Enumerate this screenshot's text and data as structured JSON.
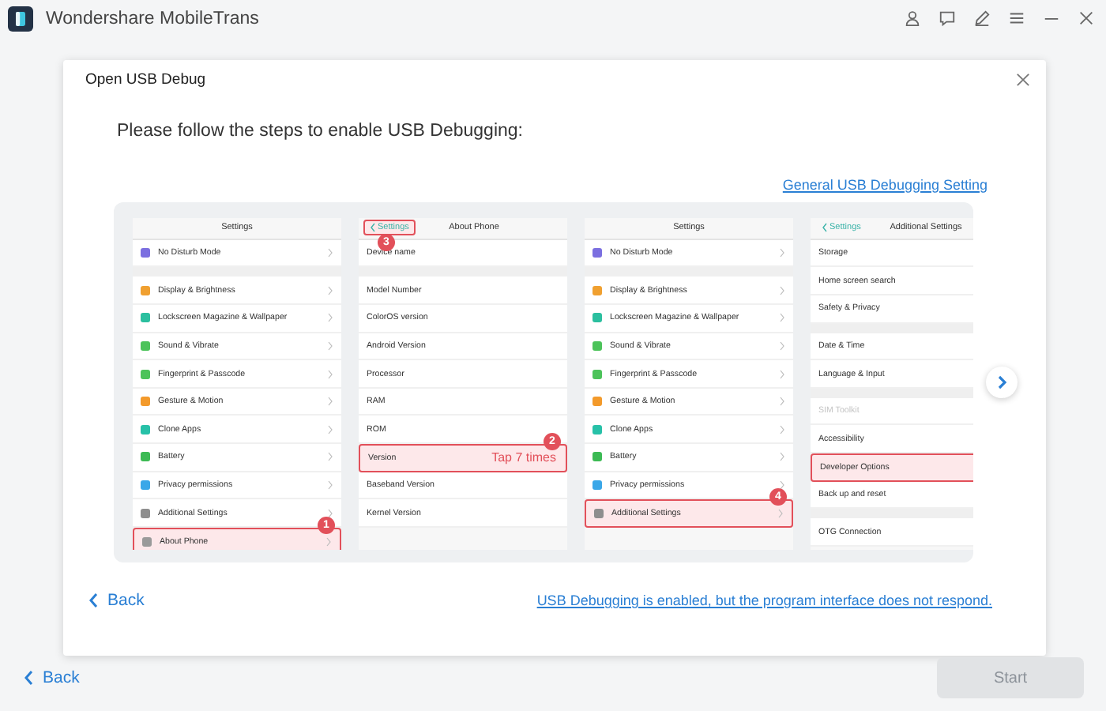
{
  "app": {
    "title": "Wondershare MobileTrans"
  },
  "dialog": {
    "title": "Open USB Debug",
    "instruction": "Please follow the steps to enable USB Debugging:",
    "general_link": "General USB Debugging Setting",
    "back": "Back",
    "problem_link": "USB Debugging is enabled, but the program interface does not respond."
  },
  "phones": [
    {
      "header": {
        "title": "Settings"
      },
      "chevrons": true,
      "rows": [
        {
          "label": "No Disturb Mode",
          "color": "#7b6fe0",
          "gap_before": false,
          "highlighted": false,
          "dimmed": false
        },
        {
          "label": "Display & Brightness",
          "color": "#f0a030",
          "gap_before": true,
          "highlighted": false,
          "dimmed": false
        },
        {
          "label": "Lockscreen Magazine & Wallpaper",
          "color": "#2bbf9f",
          "gap_before": false,
          "highlighted": false,
          "dimmed": false
        },
        {
          "label": "Sound & Vibrate",
          "color": "#4cc35a",
          "gap_before": false,
          "highlighted": false,
          "dimmed": false
        },
        {
          "label": "Fingerprint & Passcode",
          "color": "#4cc35a",
          "gap_before": false,
          "highlighted": false,
          "dimmed": false
        },
        {
          "label": "Gesture & Motion",
          "color": "#f39a2b",
          "gap_before": false,
          "highlighted": false,
          "dimmed": false
        },
        {
          "label": "Clone Apps",
          "color": "#27c1a8",
          "gap_before": false,
          "highlighted": false,
          "dimmed": false
        },
        {
          "label": "Battery",
          "color": "#3cba54",
          "gap_before": false,
          "highlighted": false,
          "dimmed": false
        },
        {
          "label": "Privacy permissions",
          "color": "#3aa7e8",
          "gap_before": false,
          "highlighted": false,
          "dimmed": false
        },
        {
          "label": "Additional Settings",
          "color": "#8e8e8e",
          "gap_before": false,
          "highlighted": false,
          "dimmed": false,
          "badge": "1"
        },
        {
          "label": "About Phone",
          "color": "#9a9a9a",
          "gap_before": false,
          "highlighted": true,
          "dimmed": false
        }
      ]
    },
    {
      "header": {
        "title": "About Phone",
        "back": "Settings",
        "back_highlighted": true,
        "badge": "3"
      },
      "chevrons": false,
      "rows": [
        {
          "label": "Device name",
          "gap_before": false,
          "highlighted": false,
          "dimmed": false
        },
        {
          "label": "Model Number",
          "gap_before": true,
          "highlighted": false,
          "dimmed": false
        },
        {
          "label": "ColorOS version",
          "gap_before": false,
          "highlighted": false,
          "dimmed": false
        },
        {
          "label": "Android Version",
          "gap_before": false,
          "highlighted": false,
          "dimmed": false
        },
        {
          "label": "Processor",
          "gap_before": false,
          "highlighted": false,
          "dimmed": false
        },
        {
          "label": "RAM",
          "gap_before": false,
          "highlighted": false,
          "dimmed": false
        },
        {
          "label": "ROM",
          "gap_before": false,
          "highlighted": false,
          "dimmed": false,
          "badge": "2"
        },
        {
          "label": "Version",
          "gap_before": false,
          "highlighted": true,
          "dimmed": false,
          "note": "Tap 7 times"
        },
        {
          "label": "Baseband Version",
          "gap_before": false,
          "highlighted": false,
          "dimmed": false
        },
        {
          "label": "Kernel Version",
          "gap_before": false,
          "highlighted": false,
          "dimmed": false
        }
      ]
    },
    {
      "header": {
        "title": "Settings"
      },
      "chevrons": true,
      "rows": [
        {
          "label": "No Disturb Mode",
          "color": "#7b6fe0",
          "gap_before": false,
          "highlighted": false,
          "dimmed": false
        },
        {
          "label": "Display & Brightness",
          "color": "#f0a030",
          "gap_before": true,
          "highlighted": false,
          "dimmed": false
        },
        {
          "label": "Lockscreen Magazine & Wallpaper",
          "color": "#2bbf9f",
          "gap_before": false,
          "highlighted": false,
          "dimmed": false
        },
        {
          "label": "Sound & Vibrate",
          "color": "#4cc35a",
          "gap_before": false,
          "highlighted": false,
          "dimmed": false
        },
        {
          "label": "Fingerprint & Passcode",
          "color": "#4cc35a",
          "gap_before": false,
          "highlighted": false,
          "dimmed": false
        },
        {
          "label": "Gesture & Motion",
          "color": "#f39a2b",
          "gap_before": false,
          "highlighted": false,
          "dimmed": false
        },
        {
          "label": "Clone Apps",
          "color": "#27c1a8",
          "gap_before": false,
          "highlighted": false,
          "dimmed": false
        },
        {
          "label": "Battery",
          "color": "#3cba54",
          "gap_before": false,
          "highlighted": false,
          "dimmed": false
        },
        {
          "label": "Privacy permissions",
          "color": "#3aa7e8",
          "gap_before": false,
          "highlighted": false,
          "dimmed": false,
          "badge": "4"
        },
        {
          "label": "Additional Settings",
          "color": "#8e8e8e",
          "gap_before": false,
          "highlighted": true,
          "dimmed": false
        }
      ]
    },
    {
      "header": {
        "title": "Additional Settings",
        "back": "Settings",
        "back_highlighted": false
      },
      "chevrons": false,
      "rows": [
        {
          "label": "Storage",
          "gap_before": false,
          "highlighted": false,
          "dimmed": false
        },
        {
          "label": "Home screen search",
          "gap_before": false,
          "highlighted": false,
          "dimmed": false
        },
        {
          "label": "Safety & Privacy",
          "gap_before": false,
          "highlighted": false,
          "dimmed": false
        },
        {
          "label": "Date & Time",
          "gap_before": true,
          "highlighted": false,
          "dimmed": false
        },
        {
          "label": "Language & Input",
          "gap_before": false,
          "highlighted": false,
          "dimmed": false
        },
        {
          "label": "SIM Toolkit",
          "gap_before": true,
          "highlighted": false,
          "dimmed": true
        },
        {
          "label": "Accessibility",
          "gap_before": false,
          "highlighted": false,
          "dimmed": false
        },
        {
          "label": "Developer Options",
          "gap_before": false,
          "highlighted": true,
          "dimmed": false
        },
        {
          "label": "Back up and reset",
          "gap_before": false,
          "highlighted": false,
          "dimmed": false
        },
        {
          "label": "OTG Connection",
          "gap_before": true,
          "highlighted": false,
          "dimmed": false
        }
      ]
    }
  ],
  "footer": {
    "back": "Back",
    "start": {
      "label": "Start",
      "disabled": true
    }
  }
}
